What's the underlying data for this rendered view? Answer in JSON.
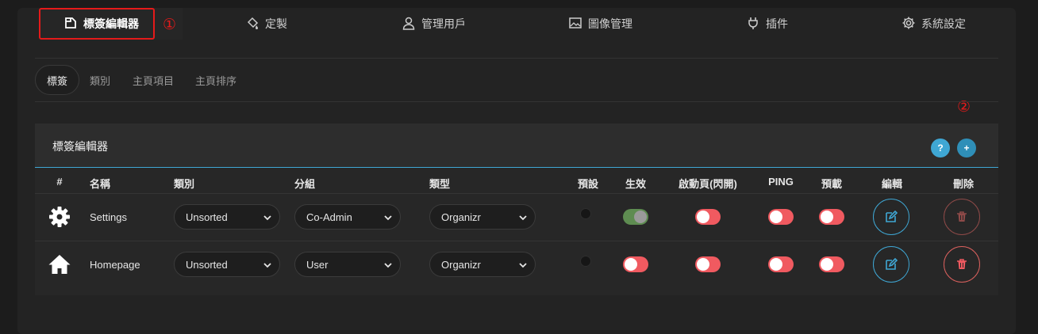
{
  "topnav": [
    {
      "label": "標簽編輯器",
      "icon": "tab-icon",
      "active": true
    },
    {
      "label": "定製",
      "icon": "paint-bucket-icon"
    },
    {
      "label": "管理用戶",
      "icon": "user-icon"
    },
    {
      "label": "圖像管理",
      "icon": "image-icon"
    },
    {
      "label": "插件",
      "icon": "plug-icon"
    },
    {
      "label": "系統設定",
      "icon": "gear-icon"
    }
  ],
  "annotations": {
    "first": "①",
    "second": "②"
  },
  "subtabs": [
    {
      "label": "標簽",
      "active": true
    },
    {
      "label": "類別"
    },
    {
      "label": "主頁項目"
    },
    {
      "label": "主頁排序"
    }
  ],
  "card": {
    "title": "標簽編輯器",
    "help_label": "?",
    "add_label": "+"
  },
  "columns": [
    "#",
    "名稱",
    "類別",
    "分組",
    "類型",
    "預設",
    "生效",
    "啟動頁(閃開)",
    "PING",
    "預載",
    "編輯",
    "刪除"
  ],
  "rows": [
    {
      "icon": "gear-icon",
      "name": "Settings",
      "category": "Unsorted",
      "group": "Co-Admin",
      "type": "Organizr",
      "active_on": true,
      "delete_dim": true
    },
    {
      "icon": "home-icon",
      "name": "Homepage",
      "category": "Unsorted",
      "group": "User",
      "type": "Organizr",
      "active_on": false,
      "delete_dim": false
    }
  ],
  "colors": {
    "accent": "#3fa7d4",
    "danger": "#f05a60",
    "annotation": "#e51a1a",
    "toggle_on": "#5e8c51"
  }
}
